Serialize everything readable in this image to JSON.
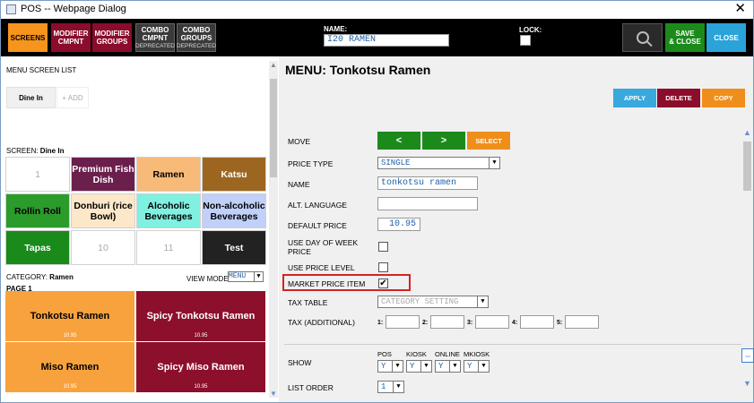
{
  "window": {
    "title": "POS -- Webpage Dialog",
    "close_glyph": "✕"
  },
  "toolbar": {
    "screens": "SCREENS",
    "modifier_cmpnt": [
      "MODIFIER",
      "CMPNT"
    ],
    "modifier_groups": [
      "MODIFIER",
      "GROUPS"
    ],
    "combo_cmpnt": [
      "COMBO",
      "CMPNT",
      "DEPRECATED"
    ],
    "combo_groups": [
      "COMBO",
      "GROUPS",
      "DEPRECATED"
    ],
    "name_label": "NAME:",
    "name_value": "I20 RAMEN",
    "lock_label": "LOCK:",
    "save_close": [
      "SAVE",
      "& CLOSE"
    ],
    "close": "CLOSE",
    "search_icon": "search-icon"
  },
  "left": {
    "menu_screen_list": "MENU SCREEN LIST",
    "tab_active": "Dine In",
    "tab_add": "+ ADD",
    "screen_prefix": "SCREEN: ",
    "screen_name": "Dine In",
    "grid": [
      {
        "label": "1",
        "style": "blank"
      },
      {
        "label": "Premium Fish Dish",
        "style": "purple"
      },
      {
        "label": "Ramen",
        "style": "peach"
      },
      {
        "label": "Katsu",
        "style": "brown"
      },
      {
        "label": "Rollin Roll",
        "style": "green"
      },
      {
        "label": "Donburi (rice Bowl)",
        "style": "cream"
      },
      {
        "label": "Alcoholic Beverages",
        "style": "cyan"
      },
      {
        "label": "Non-alcoholic Beverages",
        "style": "lav"
      },
      {
        "label": "Tapas",
        "style": "darkgreen"
      },
      {
        "label": "10",
        "style": "blank"
      },
      {
        "label": "11",
        "style": "blank"
      },
      {
        "label": "Test",
        "style": "black"
      }
    ],
    "category_prefix": "CATEGORY: ",
    "category_name": "Ramen",
    "view_mode_label": "VIEW MODE:",
    "view_mode_value": "MENU",
    "page_label": "PAGE 1",
    "items": [
      {
        "name": "Tonkotsu Ramen",
        "price": "10.95",
        "style": "orange"
      },
      {
        "name": "Spicy Tonkotsu Ramen",
        "price": "10.95",
        "style": "red"
      },
      {
        "name": "Miso Ramen",
        "price": "10.95",
        "style": "orange"
      },
      {
        "name": "Spicy Miso Ramen",
        "price": "10.95",
        "style": "red"
      }
    ]
  },
  "right": {
    "title": "MENU: Tonkotsu Ramen",
    "apply": "APPLY",
    "delete": "DELETE",
    "copy": "COPY",
    "move_label": "MOVE",
    "move_left": "<",
    "move_right": ">",
    "select": "SELECT",
    "price_type_label": "PRICE TYPE",
    "price_type_value": "SINGLE",
    "name_label": "NAME",
    "name_value": "tonkotsu ramen",
    "alt_lang_label": "ALT. LANGUAGE",
    "alt_lang_value": "",
    "default_price_label": "DEFAULT PRICE",
    "default_price_value": "10.95",
    "use_dow_label": [
      "USE DAY OF WEEK",
      "PRICE"
    ],
    "use_price_level_label": "USE PRICE LEVEL",
    "market_price_label": "MARKET PRICE ITEM",
    "market_price_checked": "✔",
    "tax_table_label": "TAX TABLE",
    "tax_table_value": "CATEGORY SETTING",
    "tax_additional_label": "TAX (ADDITIONAL)",
    "tax_fields": [
      "1:",
      "2:",
      "3:",
      "4:",
      "5:"
    ],
    "show_label": "SHOW",
    "show_cols": [
      {
        "label": "POS",
        "value": "Y"
      },
      {
        "label": "KIOSK",
        "value": "Y"
      },
      {
        "label": "ONLINE",
        "value": "Y"
      },
      {
        "label": "MKIOSK",
        "value": "Y"
      }
    ],
    "list_order_label": "LIST ORDER",
    "list_order_value": "1"
  }
}
